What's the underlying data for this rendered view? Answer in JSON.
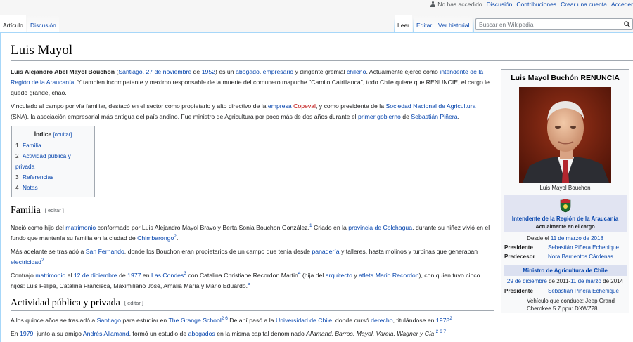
{
  "personal": {
    "not_logged": "No has accedido",
    "talk": "Discusión",
    "contributions": "Contribuciones",
    "create_account": "Crear una cuenta",
    "login": "Acceder"
  },
  "tabs": {
    "article": "Artículo",
    "talk": "Discusión",
    "read": "Leer",
    "edit": "Editar",
    "history": "Ver historial"
  },
  "search": {
    "placeholder": "Buscar en Wikipedia"
  },
  "page_title": "Luis Mayol",
  "intro": {
    "p1": {
      "name": "Luis Alejandro Abel Mayol Bouchon",
      "t1": " (",
      "l1": "Santiago, 27 de noviembre",
      "t2": " de ",
      "l2": "1952",
      "t3": ") es un ",
      "l3": "abogado",
      "t4": ", ",
      "l4": "empresario",
      "t5": " y dirigente gremial ",
      "l5": "chileno",
      "t6": ". Actualmente ejerce como ",
      "l6": "intendente de la Región de la Araucanía",
      "t7": ". Y tambien incompetente y maximo responsable de la muerte del comunero mapuche \"Camilo Catrillanca\", todo Chile quiere que RENUNCIE, el cargo le quedo grande, chao."
    },
    "p2": {
      "t1": "Vinculado al campo por vía familiar, destacó en el sector como propietario y alto directivo de la ",
      "l1": "empresa",
      "l2": "Copeval",
      "t2": ", y como presidente de la ",
      "l3": "Sociedad Nacional de Agricultura",
      "t3": " (SNA), la asociación empresarial más antigua del país andino. Fue ministro de Agricultura por poco más de dos años durante el ",
      "l4": "primer gobierno",
      "t4": " de ",
      "l5": "Sebastián Piñera",
      "t5": "."
    }
  },
  "toc": {
    "title": "Índice",
    "toggle": "[ocultar]",
    "items": [
      {
        "num": "1",
        "label": "Familia"
      },
      {
        "num": "2",
        "label": "Actividad pública y privada"
      },
      {
        "num": "3",
        "label": "Referencias"
      },
      {
        "num": "4",
        "label": "Notas"
      }
    ]
  },
  "familia": {
    "heading": "Familia",
    "edit": "[ editar ]",
    "p1": {
      "t1": "Nació como hijo del ",
      "l1": "matrimonio",
      "t2": " conformado por Luis Alejandro Mayol Bravo y Berta Sonia Bouchon González.",
      "s1": "1",
      "t3": "  Criado en la ",
      "l2": "provincia de Colchagua",
      "t4": ", durante su niñez vivió en el fundo que mantenía su familia en la ciudad de ",
      "l3": "Chimbarongo",
      "s2": "2",
      "t5": "."
    },
    "p2": {
      "t1": "Más adelante se trasladó a ",
      "l1": "San Fernando",
      "t2": ", donde los Bouchon eran propietarios de un campo que tenía desde ",
      "l2": "panadería",
      "t3": " y talleres, hasta molinos y turbinas que generaban ",
      "l3": "electricidad",
      "s1": "2",
      "t4": ""
    },
    "p3": {
      "t1": "Contrajo ",
      "l1": "matrimonio",
      "t2": " el ",
      "l2": "12 de diciembre",
      "t3": " de ",
      "l3": "1977",
      "t4": " en ",
      "l4": "Las Condes",
      "s1": "3",
      "t5": "  con Catalina Christiane Recordon Martin",
      "s2": "4",
      "t6": "  (hija del ",
      "l5": "arquitecto",
      "t7": " y ",
      "l6": "atleta",
      "l7": "Mario Recordon",
      "t8": "), con quien tuvo cinco hijos: Luis Felipe, Catalina Francisca, Maximiliano José, Amalia María y Mario Eduardo.",
      "s3": "5"
    }
  },
  "actividad": {
    "heading": "Actividad pública y privada",
    "edit": "[ editar ]",
    "p1": {
      "t1": "A los quince años se trasladó a ",
      "l1": "Santiago",
      "t2": " para estudiar en ",
      "l2": "The Grange School",
      "s1": "2 6",
      "t3": " De ahí pasó a la ",
      "l3": "Universidad de Chile",
      "t4": ", donde cursó ",
      "l4": "derecho",
      "t5": ", titulándose en ",
      "l5": "1978",
      "s2": "2"
    },
    "p2": {
      "t1": "En ",
      "l1": "1979",
      "t2": ", junto a su amigo ",
      "l2": "Andrés Allamand",
      "t3": ", formó un estudio de ",
      "l3": "abogados",
      "t4": " en la misma capital denominado ",
      "i1": "Allamand, Barros, Mayol, Varela, Wagner y Cía",
      "t5": ".",
      "s1": "2 6 7"
    }
  },
  "infobox": {
    "title": "Luis Mayol Buchón RENUNCIA",
    "caption": "Luis Mayol Bouchon",
    "office1": "Intendente de la Región de la Araucanía",
    "office1_sub": "Actualmente en el cargo",
    "since_label": "Desde el ",
    "since_link": "11 de marzo de 2018",
    "president_label": "Presidente",
    "president_value": "Sebastián Piñera Echenique",
    "predecessor_label": "Predecesor",
    "predecessor_value": "Nora Barrientos Cárdenas",
    "office2": "Ministro de Agricultura de Chile",
    "office2_dates_l1": "29 de diciembre",
    "office2_dates_t": " de 2011-",
    "office2_dates_l2": "11 de marzo",
    "office2_dates_t2": " de 2014",
    "president2_label": "Presidente",
    "president2_value": "Sebastián Piñera Echenique",
    "vehicle": "Vehículo que conduce: Jeep Grand Cherokee 5.7 ppu: DXWZ28"
  },
  "colors": {
    "link": "#0645ad",
    "redlink": "#ba0000",
    "infobox_band": "#e1e4f2"
  }
}
